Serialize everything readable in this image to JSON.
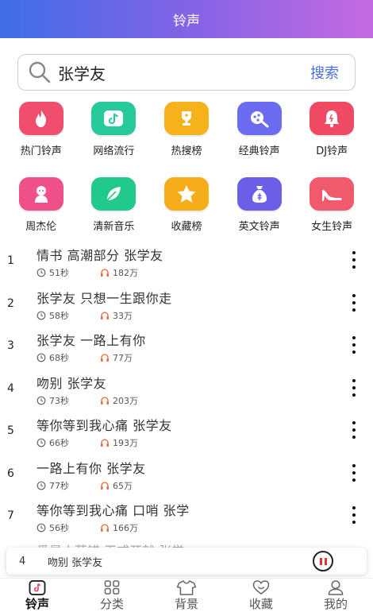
{
  "header": {
    "title": "铃声"
  },
  "search": {
    "value": "张学友",
    "button": "搜索"
  },
  "categories": [
    {
      "label": "热门铃声",
      "color": "#f04e6e",
      "icon": "fire-icon"
    },
    {
      "label": "网络流行",
      "color": "#26c99a",
      "icon": "tiktok-icon"
    },
    {
      "label": "热搜榜",
      "color": "#f5b21b",
      "icon": "trophy-icon"
    },
    {
      "label": "经典铃声",
      "color": "#6c6cf0",
      "icon": "music-note-icon"
    },
    {
      "label": "DJ铃声",
      "color": "#ee4a63",
      "icon": "bell-icon"
    },
    {
      "label": "周杰伦",
      "color": "#f0508a",
      "icon": "person-icon"
    },
    {
      "label": "清新音乐",
      "color": "#22c98c",
      "icon": "leaf-icon"
    },
    {
      "label": "收藏榜",
      "color": "#f5ae1a",
      "icon": "star-icon"
    },
    {
      "label": "英文铃声",
      "color": "#6b5fe8",
      "icon": "money-bag-icon"
    },
    {
      "label": "女生铃声",
      "color": "#f15a6c",
      "icon": "high-heel-icon"
    }
  ],
  "songs": [
    {
      "rank": "1",
      "title": "情书 高潮部分 张学友",
      "duration": "51秒",
      "plays": "182万"
    },
    {
      "rank": "2",
      "title": "张学友 只想一生跟你走",
      "duration": "58秒",
      "plays": "33万"
    },
    {
      "rank": "3",
      "title": "张学友 一路上有你",
      "duration": "68秒",
      "plays": "77万"
    },
    {
      "rank": "4",
      "title": "吻别 张学友",
      "duration": "73秒",
      "plays": "203万"
    },
    {
      "rank": "5",
      "title": "等你等到我心痛 张学友",
      "duration": "66秒",
      "plays": "193万"
    },
    {
      "rank": "6",
      "title": "一路上有你 张学友",
      "duration": "77秒",
      "plays": "65万"
    },
    {
      "rank": "7",
      "title": "等你等到我心痛 口哨 张学",
      "duration": "56秒",
      "plays": "166万"
    }
  ],
  "partial_row": "爱是小草错 无戒开就 张学",
  "player": {
    "rank": "4",
    "title": "吻别 张学友"
  },
  "tabs": [
    {
      "label": "铃声",
      "icon": "ringtone-icon",
      "active": true
    },
    {
      "label": "分类",
      "icon": "grid-icon",
      "active": false
    },
    {
      "label": "背景",
      "icon": "shirt-icon",
      "active": false
    },
    {
      "label": "收藏",
      "icon": "heart-icon",
      "active": false
    },
    {
      "label": "我的",
      "icon": "user-icon",
      "active": false
    }
  ]
}
